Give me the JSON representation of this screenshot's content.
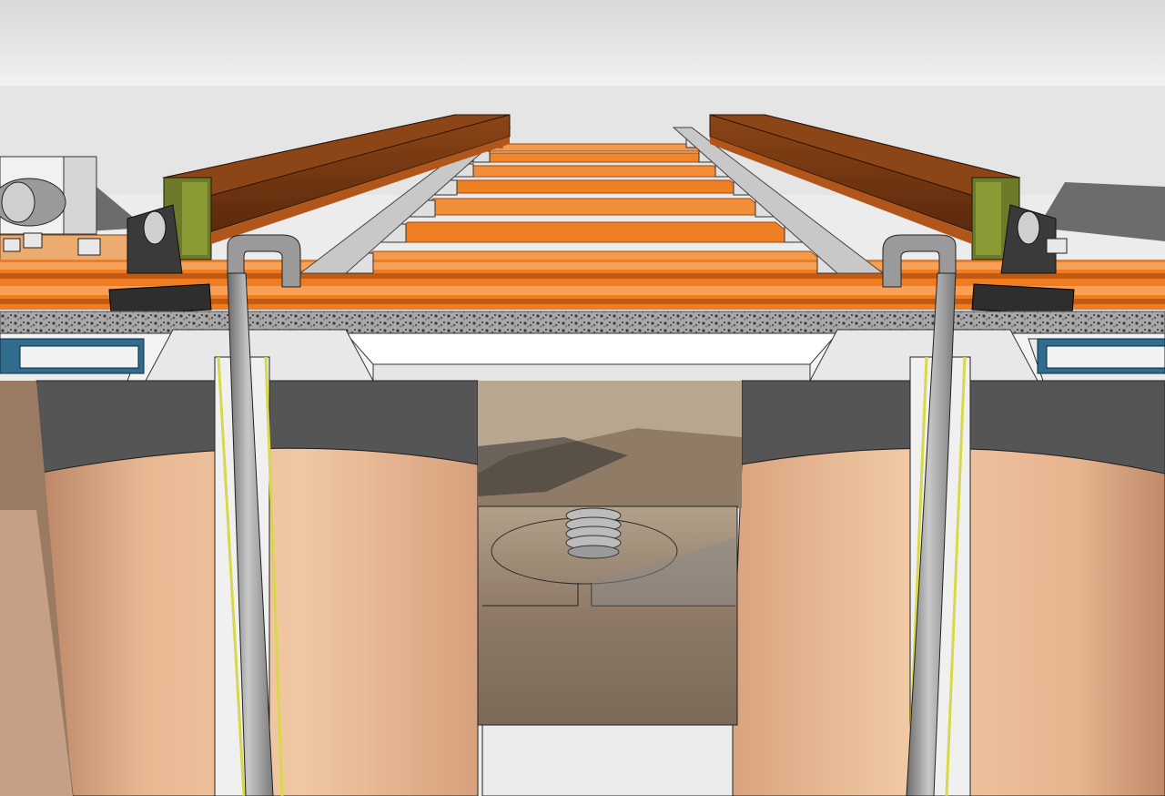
{
  "scene": {
    "description_visible_text": "",
    "colors": {
      "sky_top": "#dfdfdf",
      "sky_bottom": "#eeeeee",
      "ground": "#7a7a7a",
      "tie_orange": "#f07c22",
      "tie_light": "#f8a055",
      "tie_dark": "#c25a12",
      "rail_brown": "#6b3210",
      "rail_top": "#8c4516",
      "rail_green": "#6c7a2a",
      "ballast": "#9a9a9a",
      "deck_white": "#f4f4f4",
      "beam_blue": "#2f6c8e",
      "pile_tan": "#e7b58f",
      "pile_tan_dark": "#c99271",
      "collar_grey": "#4a4a4a",
      "pit": "#8b7763",
      "pipe_grey": "#8a8a8a",
      "pipe_light": "#bdbdbd",
      "accent_yellow": "#d8d84a"
    }
  }
}
